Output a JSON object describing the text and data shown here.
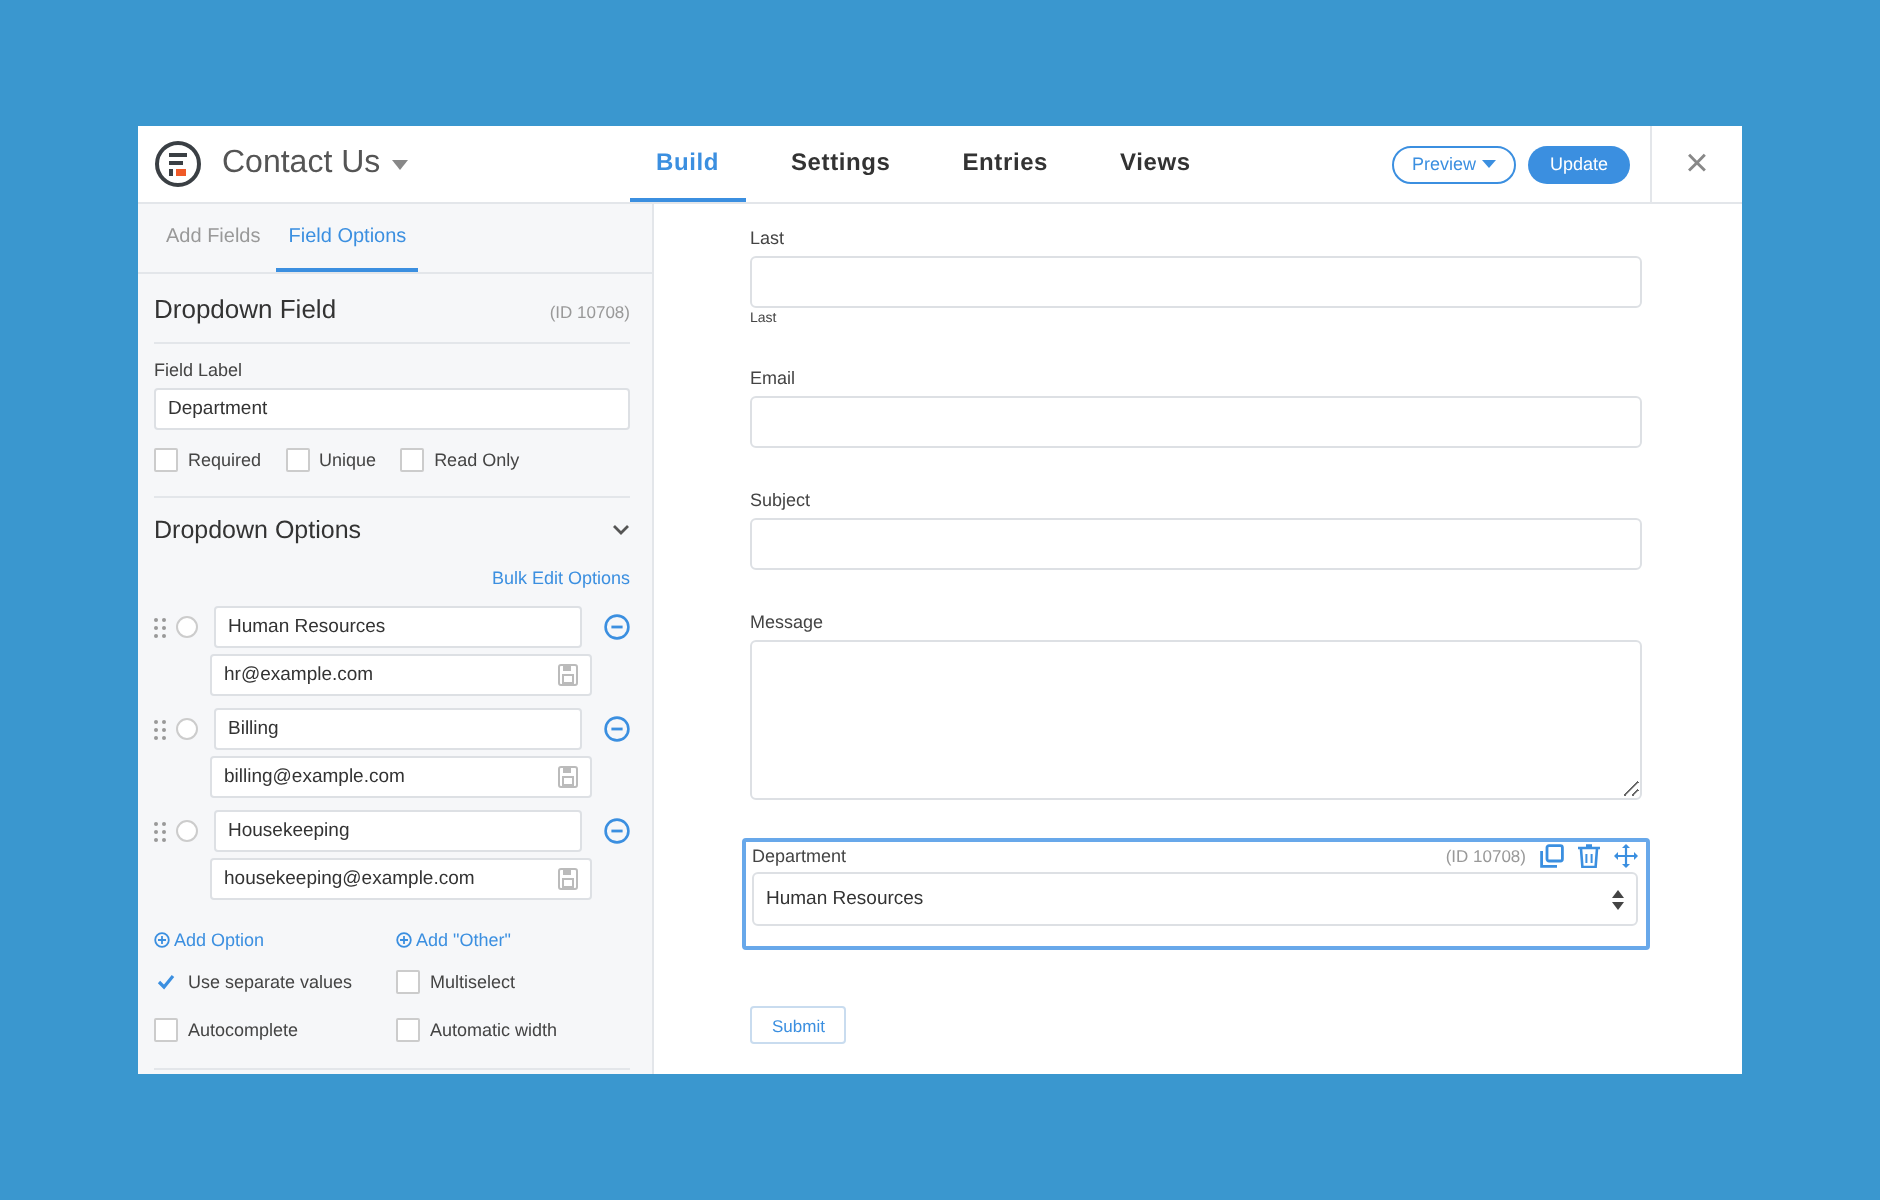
{
  "header": {
    "title": "Contact Us",
    "tabs": [
      {
        "label": "Build",
        "selected": true
      },
      {
        "label": "Settings",
        "selected": false
      },
      {
        "label": "Entries",
        "selected": false
      },
      {
        "label": "Views",
        "selected": false
      }
    ],
    "preview_button": "Preview",
    "update_button": "Update",
    "close": "×"
  },
  "sidebar": {
    "tabs": [
      {
        "label": "Add Fields",
        "selected": false
      },
      {
        "label": "Field Options",
        "selected": true
      }
    ],
    "heading": "Dropdown Field",
    "field_id": "(ID 10708)",
    "field_label": {
      "label": "Field Label",
      "value": "Department"
    },
    "flags": [
      {
        "label": "Required",
        "checked": false
      },
      {
        "label": "Unique",
        "checked": false
      },
      {
        "label": "Read Only",
        "checked": false
      }
    ],
    "options_section": {
      "title": "Dropdown Options",
      "expanded": true,
      "bulk_edit": "Bulk Edit Options",
      "options": [
        {
          "label": "Human Resources",
          "value": "hr@example.com",
          "selected": false
        },
        {
          "label": "Billing",
          "value": "billing@example.com",
          "selected": false
        },
        {
          "label": "Housekeeping",
          "value": "housekeeping@example.com",
          "selected": false
        }
      ],
      "add_option": "Add Option",
      "add_other": "Add \"Other\"",
      "settings": [
        {
          "label": "Use separate values",
          "checked": true
        },
        {
          "label": "Multiselect",
          "checked": false
        },
        {
          "label": "Autocomplete",
          "checked": false
        },
        {
          "label": "Automatic width",
          "checked": false
        }
      ]
    }
  },
  "form": {
    "fields": [
      {
        "kind": "text",
        "label": "Last",
        "sublabel": "Last",
        "selected": false
      },
      {
        "kind": "text",
        "label": "Email",
        "selected": false
      },
      {
        "kind": "text",
        "label": "Subject",
        "selected": false
      },
      {
        "kind": "textarea",
        "label": "Message",
        "selected": false
      },
      {
        "kind": "select",
        "label": "Department",
        "field_id": "(ID 10708)",
        "value": "Human Resources",
        "selected": true
      }
    ],
    "submit": "Submit"
  }
}
